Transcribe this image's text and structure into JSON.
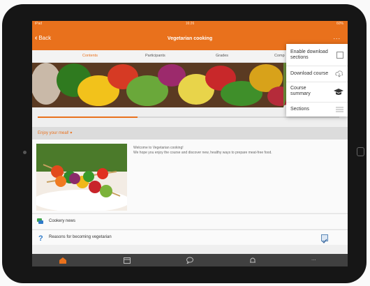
{
  "status": {
    "carrier": "iPad",
    "time": "16:26",
    "battery": "60%"
  },
  "nav": {
    "back_label": "Back",
    "title": "Vegetarian cooking",
    "more_label": "..."
  },
  "tabs": [
    {
      "label": "Contents",
      "active": true
    },
    {
      "label": "Participants",
      "active": false
    },
    {
      "label": "Grades",
      "active": false
    },
    {
      "label": "Comp",
      "active": false
    }
  ],
  "course_progress": 0.33,
  "section": {
    "title": "Enjoy your meal!"
  },
  "intro": {
    "line1": "Welcome to Vegetarian cooking!",
    "line2": "We hope you enjoy the course and discover  new, healthy ways to prepare meat-free food."
  },
  "activities": [
    {
      "label": "Cookery news",
      "icon": "forum-icon"
    },
    {
      "label": "Reasons for becoming vegetarian",
      "icon": "question-icon",
      "completed": true
    }
  ],
  "menu": {
    "items": [
      {
        "label": "Enable download sections",
        "icon": "checkbox-icon"
      },
      {
        "label": "Download course",
        "icon": "cloud-download-icon"
      },
      {
        "label": "Course summary",
        "icon": "graduation-cap-icon"
      },
      {
        "label": "Sections",
        "icon": "menu-lines-icon"
      }
    ]
  },
  "bottom_nav": [
    {
      "name": "home",
      "icon": "home-icon",
      "active": true
    },
    {
      "name": "calendar",
      "icon": "calendar-icon"
    },
    {
      "name": "messages",
      "icon": "chat-icon"
    },
    {
      "name": "notifications",
      "icon": "bell-icon"
    },
    {
      "name": "more",
      "icon": "more-icon",
      "label": "..."
    }
  ],
  "colors": {
    "accent": "#e9711c",
    "bottom_bar": "#404040",
    "section_bar": "#dcdcdc"
  }
}
